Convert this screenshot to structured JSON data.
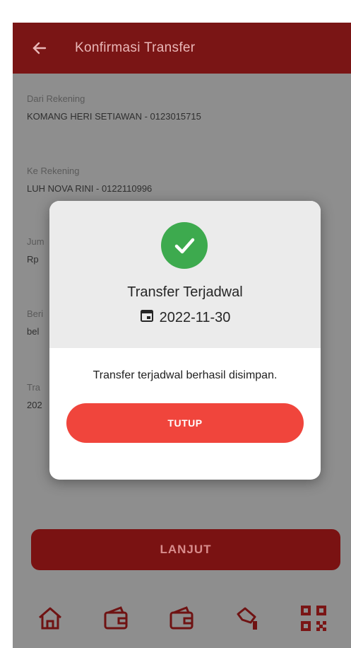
{
  "header": {
    "title": "Konfirmasi Transfer"
  },
  "form": {
    "from_label": "Dari Rekening",
    "from_value": "KOMANG HERI SETIAWAN - 0123015715",
    "to_label": "Ke Rekening",
    "to_value": "LUH NOVA RINI - 0122110996",
    "amount_label": "Jum",
    "amount_value": "Rp",
    "note_label": "Beri",
    "note_value": "bel",
    "date_label": "Tra",
    "date_value": "202"
  },
  "modal": {
    "title": "Transfer Terjadwal",
    "date": "2022-11-30",
    "message": "Transfer terjadwal berhasil disimpan.",
    "close_label": "TUTUP"
  },
  "footer": {
    "next_label": "LANJUT"
  },
  "colors": {
    "brand": "#7a1515",
    "success": "#3daa4e",
    "button": "#f0453c"
  }
}
